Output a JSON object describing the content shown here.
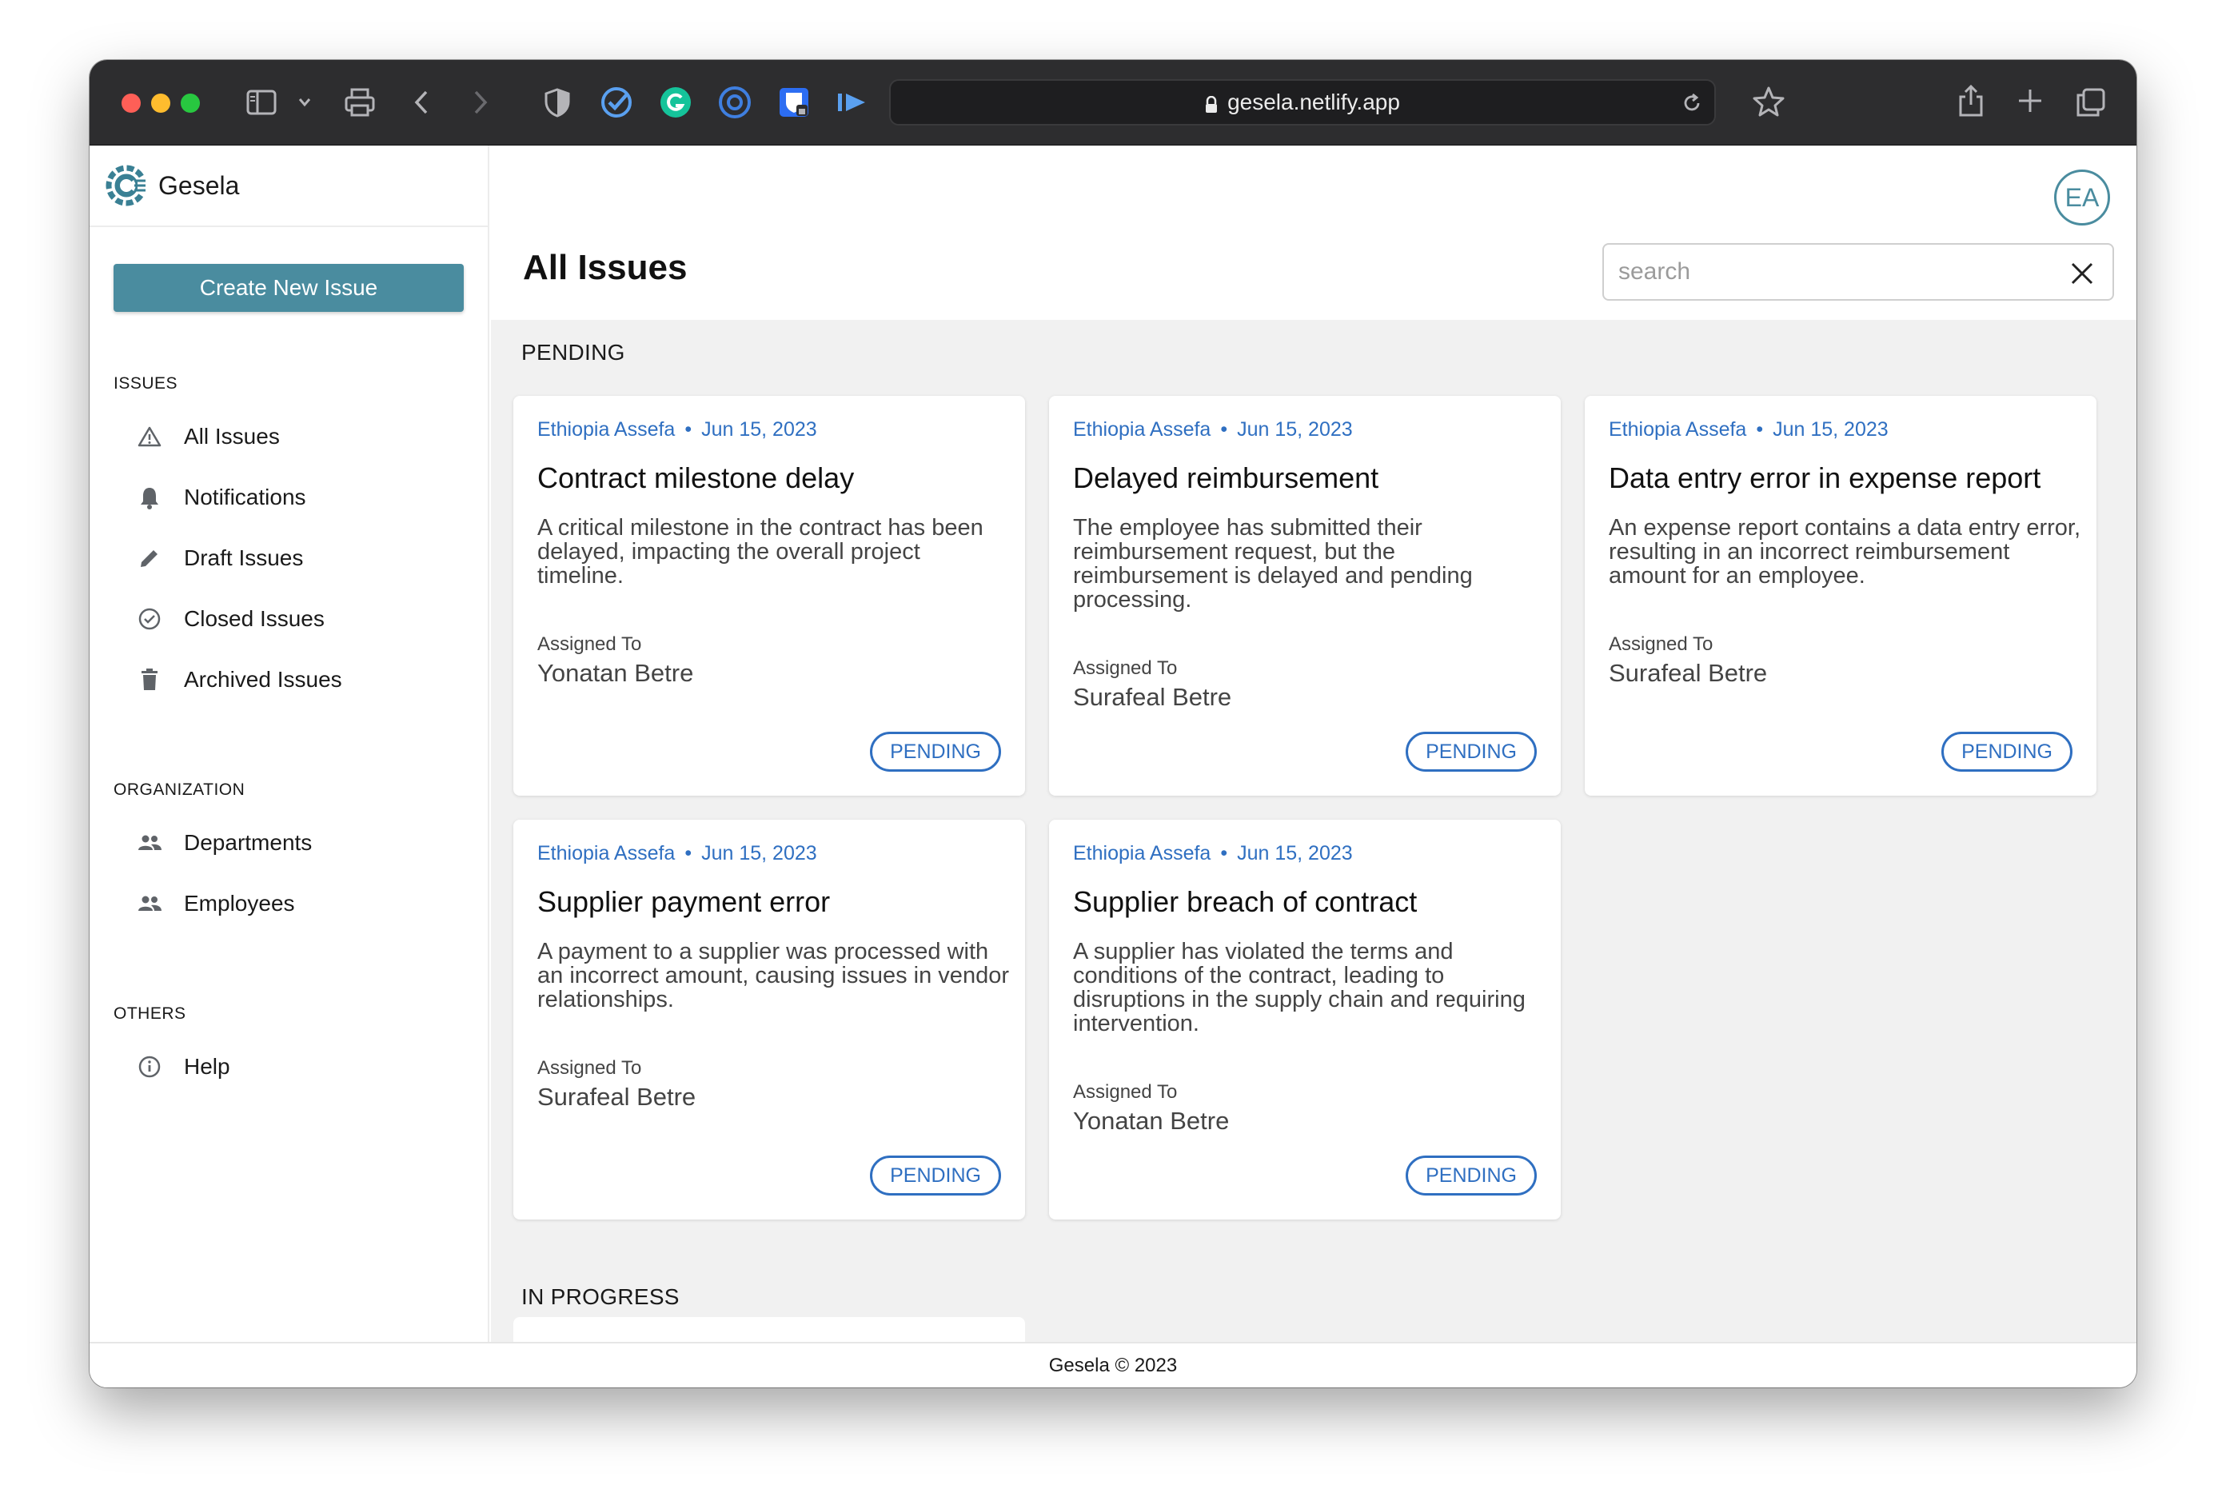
{
  "browser": {
    "url": "gesela.netlify.app"
  },
  "app": {
    "brand_name": "Gesela",
    "brand_color": "#4a8c9f",
    "create_button_label": "Create New Issue",
    "avatar_initials": "EA"
  },
  "sidebar": {
    "sections": [
      {
        "label": "ISSUES",
        "items": [
          {
            "label": "All Issues",
            "icon": "warning-icon"
          },
          {
            "label": "Notifications",
            "icon": "bell-icon"
          },
          {
            "label": "Draft Issues",
            "icon": "pencil-icon"
          },
          {
            "label": "Closed Issues",
            "icon": "check-circle-icon"
          },
          {
            "label": "Archived Issues",
            "icon": "trash-icon"
          }
        ]
      },
      {
        "label": "ORGANIZATION",
        "items": [
          {
            "label": "Departments",
            "icon": "people-icon"
          },
          {
            "label": "Employees",
            "icon": "people-icon"
          }
        ]
      },
      {
        "label": "OTHERS",
        "items": [
          {
            "label": "Help",
            "icon": "info-icon"
          }
        ]
      }
    ]
  },
  "main": {
    "page_title": "All Issues",
    "search_placeholder": "search",
    "groups": [
      {
        "label": "PENDING",
        "cards": [
          {
            "author": "Ethiopia Assefa",
            "date": "Jun 15, 2023",
            "title": "Contract milestone delay",
            "description": "A critical milestone in the contract has been delayed, impacting the overall project timeline.",
            "assigned_label": "Assigned To",
            "assignee": "Yonatan Betre",
            "status": "PENDING"
          },
          {
            "author": "Ethiopia Assefa",
            "date": "Jun 15, 2023",
            "title": "Delayed reimbursement",
            "description": "The employee has submitted their reimbursement request, but the reimbursement is delayed and pending processing.",
            "assigned_label": "Assigned To",
            "assignee": "Surafeal Betre",
            "status": "PENDING"
          },
          {
            "author": "Ethiopia Assefa",
            "date": "Jun 15, 2023",
            "title": "Data entry error in expense report",
            "description": "An expense report contains a data entry error, resulting in an incorrect reimbursement amount for an employee.",
            "assigned_label": "Assigned To",
            "assignee": "Surafeal Betre",
            "status": "PENDING"
          },
          {
            "author": "Ethiopia Assefa",
            "date": "Jun 15, 2023",
            "title": "Supplier payment error",
            "description": "A payment to a supplier was processed with an incorrect amount, causing issues in vendor relationships.",
            "assigned_label": "Assigned To",
            "assignee": "Surafeal Betre",
            "status": "PENDING"
          },
          {
            "author": "Ethiopia Assefa",
            "date": "Jun 15, 2023",
            "title": "Supplier breach of contract",
            "description": "A supplier has violated the terms and conditions of the contract, leading to disruptions in the supply chain and requiring intervention.",
            "assigned_label": "Assigned To",
            "assignee": "Yonatan Betre",
            "status": "PENDING"
          }
        ]
      },
      {
        "label": "IN PROGRESS",
        "cards": []
      }
    ]
  },
  "footer": {
    "text": "Gesela © 2023"
  },
  "colors": {
    "accent": "#2f6fc1",
    "button": "#4a8c9f",
    "main_background": "#f1f1f1"
  }
}
